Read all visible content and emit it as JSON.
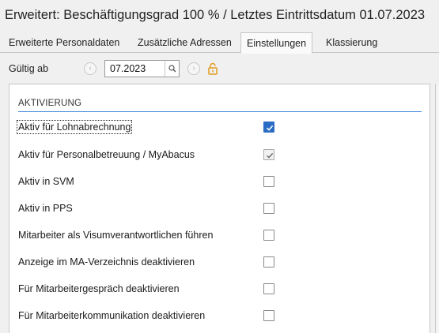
{
  "window": {
    "title": "Erweitert: Beschäftigungsgrad 100 % / Letztes Eintrittsdatum 01.07.2023"
  },
  "tabs": [
    {
      "label": "Erweiterte Personaldaten",
      "active": false
    },
    {
      "label": "Zusätzliche Adressen",
      "active": false
    },
    {
      "label": "Einstellungen",
      "active": true
    },
    {
      "label": "Klassierung",
      "active": false
    }
  ],
  "toolbar": {
    "valid_from_label": "Gültig ab",
    "date_value": "07.2023",
    "prev_icon": "chevron-left-icon",
    "next_icon": "chevron-right-icon",
    "search_icon": "search-icon",
    "lock_icon": "unlock-icon"
  },
  "section": {
    "title": "AKTIVIERUNG",
    "accent_color": "#4a90d9"
  },
  "options": [
    {
      "label": "Aktiv für Lohnabrechnung",
      "checked": true,
      "state": "checked-blue"
    },
    {
      "label": "Aktiv für Personalbetreuung / MyAbacus",
      "checked": true,
      "state": "checked-disabled"
    },
    {
      "label": "Aktiv in SVM",
      "checked": false,
      "state": "unchecked"
    },
    {
      "label": "Aktiv in PPS",
      "checked": false,
      "state": "unchecked"
    },
    {
      "label": "Mitarbeiter als Visumverantwortlichen führen",
      "checked": false,
      "state": "unchecked"
    },
    {
      "label": "Anzeige im MA-Verzeichnis deaktivieren",
      "checked": false,
      "state": "unchecked"
    },
    {
      "label": "Für Mitarbeitergespräch deaktivieren",
      "checked": false,
      "state": "unchecked"
    },
    {
      "label": "Für Mitarbeiterkommunikation deaktivieren",
      "checked": false,
      "state": "unchecked"
    }
  ]
}
